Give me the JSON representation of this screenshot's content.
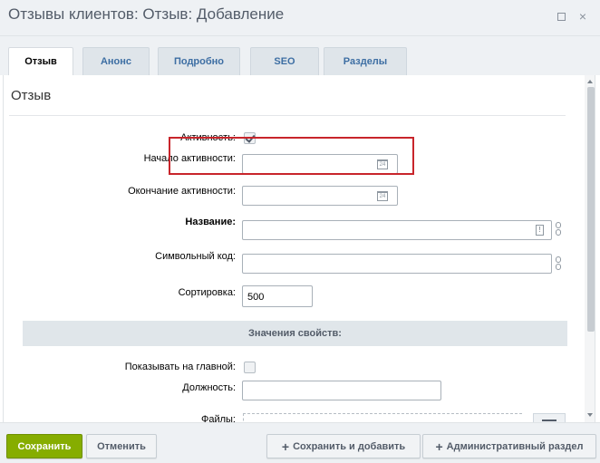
{
  "window": {
    "title": "Отзывы клиентов: Отзыв: Добавление",
    "restore_icon": "restore-window-icon",
    "close_icon": "×"
  },
  "tabs": [
    {
      "label": "Отзыв",
      "active": true
    },
    {
      "label": "Анонс",
      "active": false
    },
    {
      "label": "Подробно",
      "active": false
    },
    {
      "label": "SEO",
      "active": false
    },
    {
      "label": "Разделы",
      "active": false
    }
  ],
  "section": {
    "title": "Отзыв"
  },
  "form": {
    "active_label": "Активность:",
    "active_checked": true,
    "start_label": "Начало активности:",
    "start_value": "",
    "end_label": "Окончание активности:",
    "end_value": "",
    "name_label": "Название:",
    "name_value": "",
    "code_label": "Символьный код:",
    "code_value": "",
    "sort_label": "Сортировка:",
    "sort_value": "500",
    "calendar_icon_text": "24",
    "translit_icon_text": "!"
  },
  "properties": {
    "header": "Значения свойств:",
    "show_main_label": "Показывать на главной:",
    "show_main_checked": false,
    "position_label": "Должность:",
    "position_value": "",
    "files_label": "Файлы:"
  },
  "footer": {
    "save_label": "Сохранить",
    "cancel_label": "Отменить",
    "save_add_label": "Сохранить и добавить",
    "admin_label": "Административный раздел",
    "plus_symbol": "+"
  },
  "colors": {
    "save_green": "#86ad00",
    "highlight_red": "#c8252b",
    "tab_blue": "#3d6ea3"
  }
}
